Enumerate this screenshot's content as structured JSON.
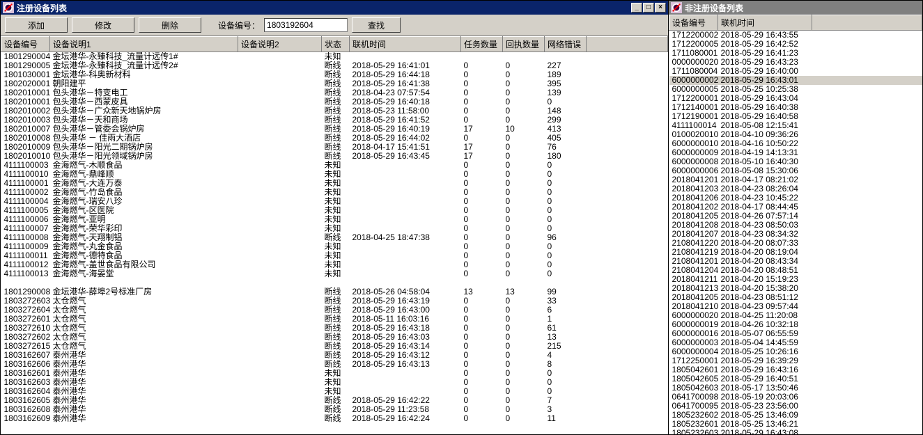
{
  "left": {
    "title": "注册设备列表",
    "toolbar": {
      "add": "添加",
      "edit": "修改",
      "delete": "删除",
      "id_label": "设备编号：",
      "id_value": "1803192604",
      "find": "查找"
    },
    "columns": {
      "id": "设备编号",
      "desc1": "设备说明1",
      "desc2": "设备说明2",
      "status": "状态",
      "conn_time": "联机时间",
      "task_num": "任务数量",
      "recv_num": "回执数量",
      "net_err": "网络错误"
    },
    "rows": [
      {
        "id": "1801290004",
        "d1": "金坛港华-永臻科技_流量计远传1#",
        "st": "未知",
        "tm": "",
        "tn": "",
        "rn": "",
        "ne": ""
      },
      {
        "id": "1801290005",
        "d1": "金坛港华-永臻科技_流量计远传2#",
        "st": "断线",
        "tm": "2018-05-29 16:41:01",
        "tn": "0",
        "rn": "0",
        "ne": "227"
      },
      {
        "id": "1801030001",
        "d1": "金坛港华-科奥新材料",
        "st": "断线",
        "tm": "2018-05-29 16:44:18",
        "tn": "0",
        "rn": "0",
        "ne": "189"
      },
      {
        "id": "1802020001",
        "d1": "朝阳建平",
        "st": "断线",
        "tm": "2018-05-29 16:41:38",
        "tn": "0",
        "rn": "0",
        "ne": "395"
      },
      {
        "id": "1802010001",
        "d1": "包头港华－特变电工",
        "st": "断线",
        "tm": "2018-04-23 07:57:54",
        "tn": "0",
        "rn": "0",
        "ne": "139"
      },
      {
        "id": "1802010001",
        "d1": "包头港华－西蒙皮具",
        "st": "断线",
        "tm": "2018-05-29 16:40:18",
        "tn": "0",
        "rn": "0",
        "ne": "0"
      },
      {
        "id": "1802010002",
        "d1": "包头港华－广众新天地锅炉房",
        "st": "断线",
        "tm": "2018-05-23 11:58:00",
        "tn": "0",
        "rn": "0",
        "ne": "148"
      },
      {
        "id": "1802010003",
        "d1": "包头港华－天和商场",
        "st": "断线",
        "tm": "2018-05-29 16:41:52",
        "tn": "0",
        "rn": "0",
        "ne": "299"
      },
      {
        "id": "1802010007",
        "d1": "包头港华－管委会锅炉房",
        "st": "断线",
        "tm": "2018-05-29 16:40:19",
        "tn": "17",
        "rn": "10",
        "ne": "413"
      },
      {
        "id": "1802010008",
        "d1": "包头港华 － 佳雨大酒店",
        "st": "断线",
        "tm": "2018-05-29 16:44:02",
        "tn": "0",
        "rn": "0",
        "ne": "405"
      },
      {
        "id": "1802010009",
        "d1": "包头港华－阳光二期锅炉房",
        "st": "断线",
        "tm": "2018-04-17 15:41:51",
        "tn": "17",
        "rn": "0",
        "ne": "76"
      },
      {
        "id": "1802010010",
        "d1": "包头港华－阳光领域锅炉房",
        "st": "断线",
        "tm": "2018-05-29 16:43:45",
        "tn": "17",
        "rn": "0",
        "ne": "180"
      },
      {
        "id": "4111100003",
        "d1": "金海燃气-木顺食品",
        "st": "未知",
        "tm": "",
        "tn": "0",
        "rn": "0",
        "ne": "0"
      },
      {
        "id": "4111100010",
        "d1": "金海燃气-鼎峰顺",
        "st": "未知",
        "tm": "",
        "tn": "0",
        "rn": "0",
        "ne": "0"
      },
      {
        "id": "4111100001",
        "d1": "金海燃气-大连万泰",
        "st": "未知",
        "tm": "",
        "tn": "0",
        "rn": "0",
        "ne": "0"
      },
      {
        "id": "4111100002",
        "d1": "金海燃气-竹岛食品",
        "st": "未知",
        "tm": "",
        "tn": "0",
        "rn": "0",
        "ne": "0"
      },
      {
        "id": "4111100004",
        "d1": "金海燃气-瑞安八珍",
        "st": "未知",
        "tm": "",
        "tn": "0",
        "rn": "0",
        "ne": "0"
      },
      {
        "id": "4111100005",
        "d1": "金海燃气-区医院",
        "st": "未知",
        "tm": "",
        "tn": "0",
        "rn": "0",
        "ne": "0"
      },
      {
        "id": "4111100006",
        "d1": "金海燃气-亚明",
        "st": "未知",
        "tm": "",
        "tn": "0",
        "rn": "0",
        "ne": "0"
      },
      {
        "id": "4111100007",
        "d1": "金海燃气-荣华彩印",
        "st": "未知",
        "tm": "",
        "tn": "0",
        "rn": "0",
        "ne": "0"
      },
      {
        "id": "4111100008",
        "d1": "金海燃气-天翔制铝",
        "st": "断线",
        "tm": "2018-04-25 18:47:38",
        "tn": "0",
        "rn": "0",
        "ne": "96"
      },
      {
        "id": "4111100009",
        "d1": "金海燃气-丸金食品",
        "st": "未知",
        "tm": "",
        "tn": "0",
        "rn": "0",
        "ne": "0"
      },
      {
        "id": "4111100011",
        "d1": "金海燃气-德特食品",
        "st": "未知",
        "tm": "",
        "tn": "0",
        "rn": "0",
        "ne": "0"
      },
      {
        "id": "4111100012",
        "d1": "金海燃气-盖世食品有限公司",
        "st": "未知",
        "tm": "",
        "tn": "0",
        "rn": "0",
        "ne": "0"
      },
      {
        "id": "4111100013",
        "d1": "金海燃气-海晏堂",
        "st": "未知",
        "tm": "",
        "tn": "0",
        "rn": "0",
        "ne": "0"
      },
      {
        "id": "",
        "d1": "",
        "st": "",
        "tm": "",
        "tn": "",
        "rn": "",
        "ne": ""
      },
      {
        "id": "1801290008",
        "d1": "金坛港华-薛埠2号标准厂房",
        "st": "断线",
        "tm": "2018-05-26 04:58:04",
        "tn": "13",
        "rn": "13",
        "ne": "99"
      },
      {
        "id": "1803272603",
        "d1": "太仓燃气",
        "st": "断线",
        "tm": "2018-05-29 16:43:19",
        "tn": "0",
        "rn": "0",
        "ne": "33"
      },
      {
        "id": "1803272604",
        "d1": "太仓燃气",
        "st": "断线",
        "tm": "2018-05-29 16:43:00",
        "tn": "0",
        "rn": "0",
        "ne": "6"
      },
      {
        "id": "1803272601",
        "d1": "太仓燃气",
        "st": "断线",
        "tm": "2018-05-11 16:03:16",
        "tn": "0",
        "rn": "0",
        "ne": "1"
      },
      {
        "id": "1803272610",
        "d1": "太仓燃气",
        "st": "断线",
        "tm": "2018-05-29 16:43:18",
        "tn": "0",
        "rn": "0",
        "ne": "61"
      },
      {
        "id": "1803272602",
        "d1": "太仓燃气",
        "st": "断线",
        "tm": "2018-05-29 16:43:03",
        "tn": "0",
        "rn": "0",
        "ne": "13"
      },
      {
        "id": "1803272615",
        "d1": "太仓燃气",
        "st": "断线",
        "tm": "2018-05-29 16:43:14",
        "tn": "0",
        "rn": "0",
        "ne": "215"
      },
      {
        "id": "1803162607",
        "d1": "泰州港华",
        "st": "断线",
        "tm": "2018-05-29 16:43:12",
        "tn": "0",
        "rn": "0",
        "ne": "4"
      },
      {
        "id": "1803162606",
        "d1": "泰州港华",
        "st": "断线",
        "tm": "2018-05-29 16:43:13",
        "tn": "0",
        "rn": "0",
        "ne": "8"
      },
      {
        "id": "1803162601",
        "d1": "泰州港华",
        "st": "未知",
        "tm": "",
        "tn": "0",
        "rn": "0",
        "ne": "0"
      },
      {
        "id": "1803162603",
        "d1": "泰州港华",
        "st": "未知",
        "tm": "",
        "tn": "0",
        "rn": "0",
        "ne": "0"
      },
      {
        "id": "1803162604",
        "d1": "泰州港华",
        "st": "未知",
        "tm": "",
        "tn": "0",
        "rn": "0",
        "ne": "0"
      },
      {
        "id": "1803162605",
        "d1": "泰州港华",
        "st": "断线",
        "tm": "2018-05-29 16:42:22",
        "tn": "0",
        "rn": "0",
        "ne": "7"
      },
      {
        "id": "1803162608",
        "d1": "泰州港华",
        "st": "断线",
        "tm": "2018-05-29 11:23:58",
        "tn": "0",
        "rn": "0",
        "ne": "3"
      },
      {
        "id": "1803162609",
        "d1": "泰州港华",
        "st": "断线",
        "tm": "2018-05-29 16:42:24",
        "tn": "0",
        "rn": "0",
        "ne": "11"
      }
    ]
  },
  "right": {
    "title": "非注册设备列表",
    "columns": {
      "id": "设备编号",
      "conn_time": "联机时间"
    },
    "selected_index": 5,
    "rows": [
      {
        "id": "1712200002",
        "tm": "2018-05-29 16:43:55"
      },
      {
        "id": "1712200005",
        "tm": "2018-05-29 16:42:52"
      },
      {
        "id": "1711080001",
        "tm": "2018-05-29 16:41:23"
      },
      {
        "id": "0000000020",
        "tm": "2018-05-29 16:43:23"
      },
      {
        "id": "1711080004",
        "tm": "2018-05-29 16:40:00"
      },
      {
        "id": "6000000002",
        "tm": "2018-05-29 16:43:01"
      },
      {
        "id": "6000000005",
        "tm": "2018-05-25 10:25:38"
      },
      {
        "id": "1712200001",
        "tm": "2018-05-29 16:43:04"
      },
      {
        "id": "1712140001",
        "tm": "2018-05-29 16:40:38"
      },
      {
        "id": "1712190001",
        "tm": "2018-05-29 16:40:58"
      },
      {
        "id": "4111100014",
        "tm": "2018-05-08 12:15:41"
      },
      {
        "id": "0100020010",
        "tm": "2018-04-10 09:36:26"
      },
      {
        "id": "6000000010",
        "tm": "2018-04-16 10:50:22"
      },
      {
        "id": "6000000009",
        "tm": "2018-04-19 14:13:31"
      },
      {
        "id": "6000000008",
        "tm": "2018-05-10 16:40:30"
      },
      {
        "id": "6000000006",
        "tm": "2018-05-08 15:30:06"
      },
      {
        "id": "2018041201",
        "tm": "2018-04-17 08:21:02"
      },
      {
        "id": "2018041203",
        "tm": "2018-04-23 08:26:04"
      },
      {
        "id": "2018041206",
        "tm": "2018-04-23 10:45:22"
      },
      {
        "id": "2018041202",
        "tm": "2018-04-17 08:44:45"
      },
      {
        "id": "2018041205",
        "tm": "2018-04-26 07:57:14"
      },
      {
        "id": "2018041208",
        "tm": "2018-04-23 08:50:03"
      },
      {
        "id": "2018041207",
        "tm": "2018-04-23 08:34:32"
      },
      {
        "id": "2108041220",
        "tm": "2018-04-20 08:07:33"
      },
      {
        "id": "2108041219",
        "tm": "2018-04-20 08:19:04"
      },
      {
        "id": "2108041201",
        "tm": "2018-04-20 08:43:34"
      },
      {
        "id": "2108041204",
        "tm": "2018-04-20 08:48:51"
      },
      {
        "id": "2018041211",
        "tm": "2018-04-20 15:19:23"
      },
      {
        "id": "2018041213",
        "tm": "2018-04-20 15:38:20"
      },
      {
        "id": "2018041205",
        "tm": "2018-04-23 08:51:12"
      },
      {
        "id": "2018041210",
        "tm": "2018-04-23 09:57:44"
      },
      {
        "id": "6000000020",
        "tm": "2018-04-25 11:20:08"
      },
      {
        "id": "6000000019",
        "tm": "2018-04-26 10:32:18"
      },
      {
        "id": "6000000016",
        "tm": "2018-05-07 06:55:59"
      },
      {
        "id": "6000000003",
        "tm": "2018-05-04 14:45:59"
      },
      {
        "id": "6000000004",
        "tm": "2018-05-25 10:26:16"
      },
      {
        "id": "1712250001",
        "tm": "2018-05-29 16:39:29"
      },
      {
        "id": "1805042601",
        "tm": "2018-05-29 16:43:16"
      },
      {
        "id": "1805042605",
        "tm": "2018-05-29 16:40:51"
      },
      {
        "id": "1805042603",
        "tm": "2018-05-17 13:50:46"
      },
      {
        "id": "0641700098",
        "tm": "2018-05-19 20:03:06"
      },
      {
        "id": "0641700095",
        "tm": "2018-05-23 23:56:00"
      },
      {
        "id": "1805232602",
        "tm": "2018-05-25 13:46:09"
      },
      {
        "id": "1805232601",
        "tm": "2018-05-25 13:46:21"
      },
      {
        "id": "1805232603",
        "tm": "2018-05-29 16:43:08"
      }
    ]
  }
}
